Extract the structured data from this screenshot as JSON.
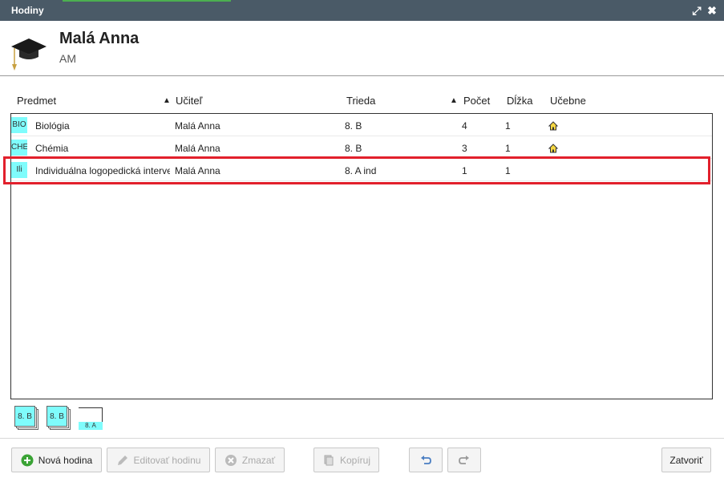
{
  "window": {
    "title": "Hodiny",
    "expand_glyph": "⤢",
    "close_glyph": "✖"
  },
  "header": {
    "icon": "graduation-cap-icon",
    "name": "Malá Anna",
    "short": "AM"
  },
  "columns": {
    "subject": "Predmet",
    "teacher": "Učiteľ",
    "class": "Trieda",
    "count": "Počet",
    "length": "Dĺžka",
    "rooms": "Učebne",
    "sort_glyph": "▲"
  },
  "rows": [
    {
      "badge": "BIO",
      "subject": "Biológia",
      "teacher": "Malá Anna",
      "class": "8. B",
      "count": "4",
      "length": "1",
      "rooms_icon": "home-icon"
    },
    {
      "badge": "CHE",
      "subject": "Chémia",
      "teacher": "Malá Anna",
      "class": "8. B",
      "count": "3",
      "length": "1",
      "rooms_icon": "home-icon"
    },
    {
      "badge": "Ili",
      "subject": "Individuálna logopedická interve",
      "teacher": "Malá Anna",
      "class": "8. A ind",
      "count": "1",
      "length": "1",
      "rooms_icon": ""
    }
  ],
  "class_cards": [
    {
      "label": "8. B"
    },
    {
      "label": "8. B"
    },
    {
      "label": "8. A"
    }
  ],
  "footer": {
    "new": "Nová hodina",
    "edit": "Editovať hodinu",
    "delete": "Zmazať",
    "copy": "Kopíruj",
    "close": "Zatvoriť"
  },
  "colors": {
    "titlebar": "#4a5a67",
    "badge": "#7ffcfc",
    "highlight": "#e2202c",
    "add_green": "#3aa335"
  }
}
